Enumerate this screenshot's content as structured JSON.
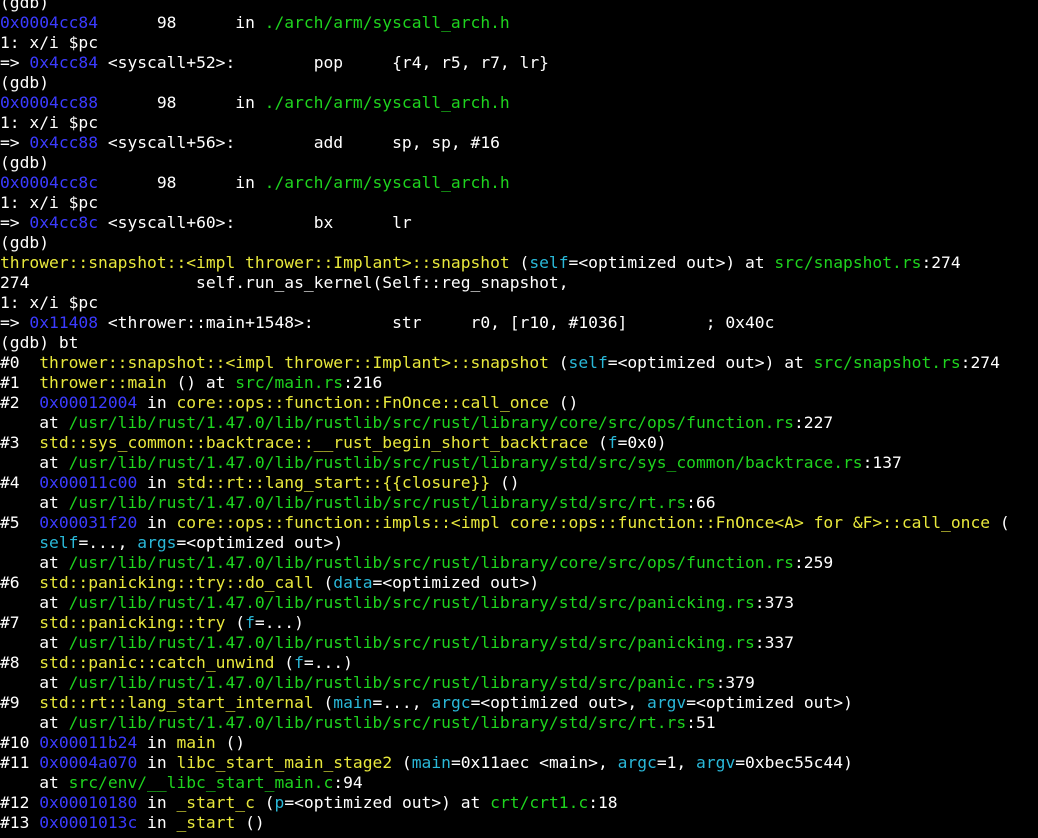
{
  "colors": {
    "background": "#000000",
    "fg": "#ffffff",
    "addr": "#3b3bff",
    "file": "#1ed41e",
    "param": "#2ab8d8",
    "func": "#e8e83c"
  },
  "lines": [
    [
      {
        "t": "(gdb)",
        "c": "fg"
      }
    ],
    [
      {
        "t": "0x0004cc84",
        "c": "addr"
      },
      {
        "t": "      98      in ",
        "c": "fg"
      },
      {
        "t": "./arch/arm/syscall_arch.h",
        "c": "file"
      }
    ],
    [
      {
        "t": "1: x/i $pc",
        "c": "fg"
      }
    ],
    [
      {
        "t": "=> ",
        "c": "fg"
      },
      {
        "t": "0x4cc84",
        "c": "addr"
      },
      {
        "t": " <syscall+52>:        pop     {r4, r5, r7, lr}",
        "c": "fg"
      }
    ],
    [
      {
        "t": "(gdb)",
        "c": "fg"
      }
    ],
    [
      {
        "t": "0x0004cc88",
        "c": "addr"
      },
      {
        "t": "      98      in ",
        "c": "fg"
      },
      {
        "t": "./arch/arm/syscall_arch.h",
        "c": "file"
      }
    ],
    [
      {
        "t": "1: x/i $pc",
        "c": "fg"
      }
    ],
    [
      {
        "t": "=> ",
        "c": "fg"
      },
      {
        "t": "0x4cc88",
        "c": "addr"
      },
      {
        "t": " <syscall+56>:        add     sp, sp, #16",
        "c": "fg"
      }
    ],
    [
      {
        "t": "(gdb)",
        "c": "fg"
      }
    ],
    [
      {
        "t": "0x0004cc8c",
        "c": "addr"
      },
      {
        "t": "      98      in ",
        "c": "fg"
      },
      {
        "t": "./arch/arm/syscall_arch.h",
        "c": "file"
      }
    ],
    [
      {
        "t": "1: x/i $pc",
        "c": "fg"
      }
    ],
    [
      {
        "t": "=> ",
        "c": "fg"
      },
      {
        "t": "0x4cc8c",
        "c": "addr"
      },
      {
        "t": " <syscall+60>:        bx      lr",
        "c": "fg"
      }
    ],
    [
      {
        "t": "(gdb)",
        "c": "fg"
      }
    ],
    [
      {
        "t": "thrower::snapshot::<impl thrower::Implant>::snapshot",
        "c": "func"
      },
      {
        "t": " (",
        "c": "fg"
      },
      {
        "t": "self",
        "c": "param"
      },
      {
        "t": "=<optimized out>) at ",
        "c": "fg"
      },
      {
        "t": "src/snapshot.rs",
        "c": "file"
      },
      {
        "t": ":274",
        "c": "fg"
      }
    ],
    [
      {
        "t": "274                 self.run_as_kernel(Self::reg_snapshot,",
        "c": "fg"
      }
    ],
    [
      {
        "t": "1: x/i $pc",
        "c": "fg"
      }
    ],
    [
      {
        "t": "=> ",
        "c": "fg"
      },
      {
        "t": "0x11408",
        "c": "addr"
      },
      {
        "t": " <thrower::main+1548>:        str     r0, [r10, #1036]        ; 0x40c",
        "c": "fg"
      }
    ],
    [
      {
        "t": "(gdb) bt",
        "c": "fg"
      }
    ],
    [
      {
        "t": "#0  ",
        "c": "fg"
      },
      {
        "t": "thrower::snapshot::<impl thrower::Implant>::snapshot",
        "c": "func"
      },
      {
        "t": " (",
        "c": "fg"
      },
      {
        "t": "self",
        "c": "param"
      },
      {
        "t": "=<optimized out>) at ",
        "c": "fg"
      },
      {
        "t": "src/snapshot.rs",
        "c": "file"
      },
      {
        "t": ":274",
        "c": "fg"
      }
    ],
    [
      {
        "t": "#1  ",
        "c": "fg"
      },
      {
        "t": "thrower::main",
        "c": "func"
      },
      {
        "t": " () at ",
        "c": "fg"
      },
      {
        "t": "src/main.rs",
        "c": "file"
      },
      {
        "t": ":216",
        "c": "fg"
      }
    ],
    [
      {
        "t": "#2  ",
        "c": "fg"
      },
      {
        "t": "0x00012004",
        "c": "addr"
      },
      {
        "t": " in ",
        "c": "fg"
      },
      {
        "t": "core::ops::function::FnOnce::call_once",
        "c": "func"
      },
      {
        "t": " ()",
        "c": "fg"
      }
    ],
    [
      {
        "t": "    at ",
        "c": "fg"
      },
      {
        "t": "/usr/lib/rust/1.47.0/lib/rustlib/src/rust/library/core/src/ops/function.rs",
        "c": "file"
      },
      {
        "t": ":227",
        "c": "fg"
      }
    ],
    [
      {
        "t": "#3  ",
        "c": "fg"
      },
      {
        "t": "std::sys_common::backtrace::__rust_begin_short_backtrace",
        "c": "func"
      },
      {
        "t": " (",
        "c": "fg"
      },
      {
        "t": "f",
        "c": "param"
      },
      {
        "t": "=0x0)",
        "c": "fg"
      }
    ],
    [
      {
        "t": "    at ",
        "c": "fg"
      },
      {
        "t": "/usr/lib/rust/1.47.0/lib/rustlib/src/rust/library/std/src/sys_common/backtrace.rs",
        "c": "file"
      },
      {
        "t": ":137",
        "c": "fg"
      }
    ],
    [
      {
        "t": "#4  ",
        "c": "fg"
      },
      {
        "t": "0x00011c00",
        "c": "addr"
      },
      {
        "t": " in ",
        "c": "fg"
      },
      {
        "t": "std::rt::lang_start::{{closure}}",
        "c": "func"
      },
      {
        "t": " ()",
        "c": "fg"
      }
    ],
    [
      {
        "t": "    at ",
        "c": "fg"
      },
      {
        "t": "/usr/lib/rust/1.47.0/lib/rustlib/src/rust/library/std/src/rt.rs",
        "c": "file"
      },
      {
        "t": ":66",
        "c": "fg"
      }
    ],
    [
      {
        "t": "#5  ",
        "c": "fg"
      },
      {
        "t": "0x00031f20",
        "c": "addr"
      },
      {
        "t": " in ",
        "c": "fg"
      },
      {
        "t": "core::ops::function::impls::<impl core::ops::function::FnOnce<A> for &F>::call_once",
        "c": "func"
      },
      {
        "t": " (",
        "c": "fg"
      }
    ],
    [
      {
        "t": "    ",
        "c": "fg"
      },
      {
        "t": "self",
        "c": "param"
      },
      {
        "t": "=..., ",
        "c": "fg"
      },
      {
        "t": "args",
        "c": "param"
      },
      {
        "t": "=<optimized out>)",
        "c": "fg"
      }
    ],
    [
      {
        "t": "    at ",
        "c": "fg"
      },
      {
        "t": "/usr/lib/rust/1.47.0/lib/rustlib/src/rust/library/core/src/ops/function.rs",
        "c": "file"
      },
      {
        "t": ":259",
        "c": "fg"
      }
    ],
    [
      {
        "t": "#6  ",
        "c": "fg"
      },
      {
        "t": "std::panicking::try::do_call",
        "c": "func"
      },
      {
        "t": " (",
        "c": "fg"
      },
      {
        "t": "data",
        "c": "param"
      },
      {
        "t": "=<optimized out>)",
        "c": "fg"
      }
    ],
    [
      {
        "t": "    at ",
        "c": "fg"
      },
      {
        "t": "/usr/lib/rust/1.47.0/lib/rustlib/src/rust/library/std/src/panicking.rs",
        "c": "file"
      },
      {
        "t": ":373",
        "c": "fg"
      }
    ],
    [
      {
        "t": "#7  ",
        "c": "fg"
      },
      {
        "t": "std::panicking::try",
        "c": "func"
      },
      {
        "t": " (",
        "c": "fg"
      },
      {
        "t": "f",
        "c": "param"
      },
      {
        "t": "=...)",
        "c": "fg"
      }
    ],
    [
      {
        "t": "    at ",
        "c": "fg"
      },
      {
        "t": "/usr/lib/rust/1.47.0/lib/rustlib/src/rust/library/std/src/panicking.rs",
        "c": "file"
      },
      {
        "t": ":337",
        "c": "fg"
      }
    ],
    [
      {
        "t": "#8  ",
        "c": "fg"
      },
      {
        "t": "std::panic::catch_unwind",
        "c": "func"
      },
      {
        "t": " (",
        "c": "fg"
      },
      {
        "t": "f",
        "c": "param"
      },
      {
        "t": "=...)",
        "c": "fg"
      }
    ],
    [
      {
        "t": "    at ",
        "c": "fg"
      },
      {
        "t": "/usr/lib/rust/1.47.0/lib/rustlib/src/rust/library/std/src/panic.rs",
        "c": "file"
      },
      {
        "t": ":379",
        "c": "fg"
      }
    ],
    [
      {
        "t": "#9  ",
        "c": "fg"
      },
      {
        "t": "std::rt::lang_start_internal",
        "c": "func"
      },
      {
        "t": " (",
        "c": "fg"
      },
      {
        "t": "main",
        "c": "param"
      },
      {
        "t": "=..., ",
        "c": "fg"
      },
      {
        "t": "argc",
        "c": "param"
      },
      {
        "t": "=<optimized out>, ",
        "c": "fg"
      },
      {
        "t": "argv",
        "c": "param"
      },
      {
        "t": "=<optimized out>)",
        "c": "fg"
      }
    ],
    [
      {
        "t": "    at ",
        "c": "fg"
      },
      {
        "t": "/usr/lib/rust/1.47.0/lib/rustlib/src/rust/library/std/src/rt.rs",
        "c": "file"
      },
      {
        "t": ":51",
        "c": "fg"
      }
    ],
    [
      {
        "t": "#10 ",
        "c": "fg"
      },
      {
        "t": "0x00011b24",
        "c": "addr"
      },
      {
        "t": " in ",
        "c": "fg"
      },
      {
        "t": "main",
        "c": "func"
      },
      {
        "t": " ()",
        "c": "fg"
      }
    ],
    [
      {
        "t": "#11 ",
        "c": "fg"
      },
      {
        "t": "0x0004a070",
        "c": "addr"
      },
      {
        "t": " in ",
        "c": "fg"
      },
      {
        "t": "libc_start_main_stage2",
        "c": "func"
      },
      {
        "t": " (",
        "c": "fg"
      },
      {
        "t": "main",
        "c": "param"
      },
      {
        "t": "=0x11aec <main>, ",
        "c": "fg"
      },
      {
        "t": "argc",
        "c": "param"
      },
      {
        "t": "=1, ",
        "c": "fg"
      },
      {
        "t": "argv",
        "c": "param"
      },
      {
        "t": "=0xbec55c44)",
        "c": "fg"
      }
    ],
    [
      {
        "t": "    at ",
        "c": "fg"
      },
      {
        "t": "src/env/__libc_start_main.c",
        "c": "file"
      },
      {
        "t": ":94",
        "c": "fg"
      }
    ],
    [
      {
        "t": "#12 ",
        "c": "fg"
      },
      {
        "t": "0x00010180",
        "c": "addr"
      },
      {
        "t": " in ",
        "c": "fg"
      },
      {
        "t": "_start_c",
        "c": "func"
      },
      {
        "t": " (",
        "c": "fg"
      },
      {
        "t": "p",
        "c": "param"
      },
      {
        "t": "=<optimized out>) at ",
        "c": "fg"
      },
      {
        "t": "crt/crt1.c",
        "c": "file"
      },
      {
        "t": ":18",
        "c": "fg"
      }
    ],
    [
      {
        "t": "#13 ",
        "c": "fg"
      },
      {
        "t": "0x0001013c",
        "c": "addr"
      },
      {
        "t": " in ",
        "c": "fg"
      },
      {
        "t": "_start",
        "c": "func"
      },
      {
        "t": " ()",
        "c": "fg"
      }
    ]
  ]
}
